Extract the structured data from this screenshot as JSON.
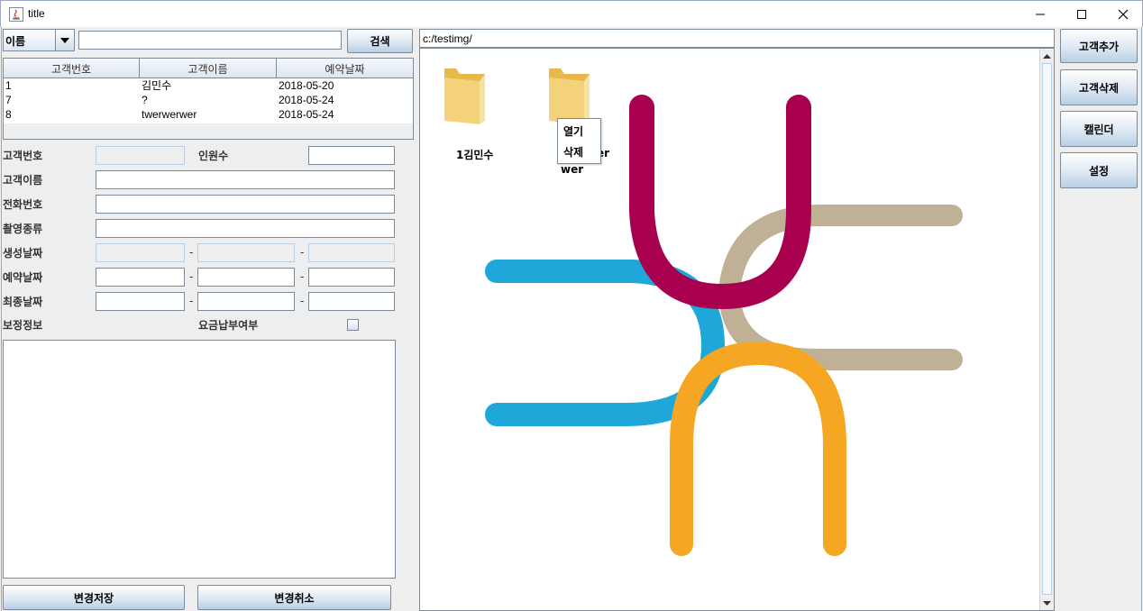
{
  "window": {
    "title": "title"
  },
  "search": {
    "combo_value": "이름",
    "query": "",
    "button_label": "검색"
  },
  "table": {
    "columns": [
      "고객번호",
      "고객이름",
      "예약날짜"
    ],
    "rows": [
      [
        "1",
        "김민수",
        "2018-05-20"
      ],
      [
        "7",
        "?",
        "2018-05-24"
      ],
      [
        "8",
        "twerwerwer",
        "2018-05-24"
      ]
    ]
  },
  "form": {
    "customer_no_label": "고객번호",
    "people_count_label": "인원수",
    "customer_name_label": "고객이름",
    "phone_label": "전화번호",
    "shoot_type_label": "촬영종류",
    "created_date_label": "생성날짜",
    "reserve_date_label": "예약날짜",
    "final_date_label": "최종날짜",
    "edit_info_label": "보정정보",
    "payment_label": "요금납부여부",
    "date_separator": "-",
    "payment_checked": false
  },
  "bottom_buttons": {
    "save": "변경저장",
    "cancel": "변경취소"
  },
  "file_panel": {
    "path": "c:/testimg/",
    "folders": [
      {
        "name": "1김민수"
      },
      {
        "name": "8twerwerwer"
      }
    ],
    "folder2_line1_tail": "er",
    "folder2_line2": "wer"
  },
  "context_menu": {
    "items": [
      "열기",
      "삭제"
    ]
  },
  "side_buttons": {
    "add": "고객추가",
    "delete": "고객삭제",
    "calendar": "캘린더",
    "settings": "설정"
  },
  "colors": {
    "logo_blue": "#1fa7d9",
    "logo_magenta": "#a8004f",
    "logo_tan": "#bfb096",
    "logo_orange": "#f5a623",
    "folder_yellow": "#f3d27a"
  }
}
